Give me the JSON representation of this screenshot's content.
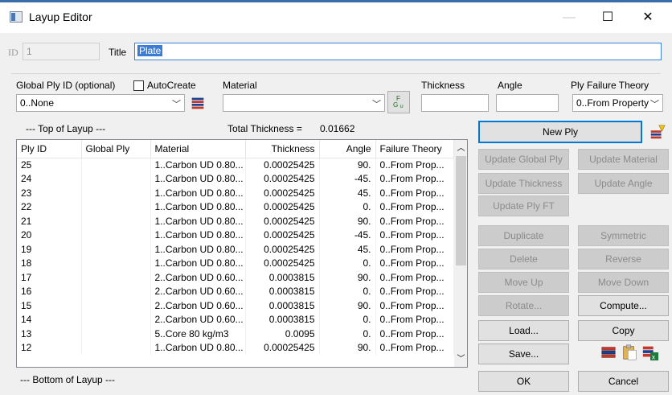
{
  "window": {
    "title": "Layup Editor",
    "minimize_glyph": "—",
    "maximize_glyph": "☐",
    "close_glyph": "✕"
  },
  "header": {
    "id_label": "ID",
    "id_value": "1",
    "title_label": "Title",
    "title_value": "Plate"
  },
  "controls": {
    "global_ply_label": "Global Ply ID (optional)",
    "global_ply_value": "0..None",
    "autocreate_label": "AutoCreate",
    "autocreate_checked": false,
    "material_label": "Material",
    "material_value": "",
    "thickness_label": "Thickness",
    "thickness_value": "",
    "angle_label": "Angle",
    "angle_value": "",
    "failure_theory_label": "Ply Failure Theory",
    "failure_theory_value": "0..From Property"
  },
  "layup": {
    "top_label": "--- Top of Layup ---",
    "total_thickness_label": "Total Thickness =",
    "total_thickness_value": "0.01662",
    "bottom_label": "--- Bottom of Layup ---",
    "columns": [
      "Ply ID",
      "Global Ply",
      "Material",
      "Thickness",
      "Angle",
      "Failure Theory"
    ],
    "rows": [
      [
        "25",
        "",
        "1..Carbon UD 0.80...",
        "0.00025425",
        "90.",
        "0..From Prop..."
      ],
      [
        "24",
        "",
        "1..Carbon UD 0.80...",
        "0.00025425",
        "-45.",
        "0..From Prop..."
      ],
      [
        "23",
        "",
        "1..Carbon UD 0.80...",
        "0.00025425",
        "45.",
        "0..From Prop..."
      ],
      [
        "22",
        "",
        "1..Carbon UD 0.80...",
        "0.00025425",
        "0.",
        "0..From Prop..."
      ],
      [
        "21",
        "",
        "1..Carbon UD 0.80...",
        "0.00025425",
        "90.",
        "0..From Prop..."
      ],
      [
        "20",
        "",
        "1..Carbon UD 0.80...",
        "0.00025425",
        "-45.",
        "0..From Prop..."
      ],
      [
        "19",
        "",
        "1..Carbon UD 0.80...",
        "0.00025425",
        "45.",
        "0..From Prop..."
      ],
      [
        "18",
        "",
        "1..Carbon UD 0.80...",
        "0.00025425",
        "0.",
        "0..From Prop..."
      ],
      [
        "17",
        "",
        "2..Carbon UD 0.60...",
        "0.0003815",
        "90.",
        "0..From Prop..."
      ],
      [
        "16",
        "",
        "2..Carbon UD 0.60...",
        "0.0003815",
        "0.",
        "0..From Prop..."
      ],
      [
        "15",
        "",
        "2..Carbon UD 0.60...",
        "0.0003815",
        "90.",
        "0..From Prop..."
      ],
      [
        "14",
        "",
        "2..Carbon UD 0.60...",
        "0.0003815",
        "0.",
        "0..From Prop..."
      ],
      [
        "13",
        "",
        "5..Core 80 kg/m3",
        "0.0095",
        "0.",
        "0..From Prop..."
      ],
      [
        "12",
        "",
        "1..Carbon UD 0.80...",
        "0.00025425",
        "90.",
        "0..From Prop..."
      ]
    ]
  },
  "buttons": {
    "new_ply": "New Ply",
    "update_global_ply": "Update Global Ply",
    "update_material": "Update Material",
    "update_thickness": "Update Thickness",
    "update_angle": "Update Angle",
    "update_ply_ft": "Update Ply FT",
    "duplicate": "Duplicate",
    "symmetric": "Symmetric",
    "delete": "Delete",
    "reverse": "Reverse",
    "move_up": "Move Up",
    "move_down": "Move Down",
    "rotate": "Rotate...",
    "compute": "Compute...",
    "load": "Load...",
    "copy": "Copy",
    "save": "Save...",
    "ok": "OK",
    "cancel": "Cancel"
  },
  "colors": {
    "accent": "#0078d7",
    "title_selection": "#3a7bd5"
  }
}
